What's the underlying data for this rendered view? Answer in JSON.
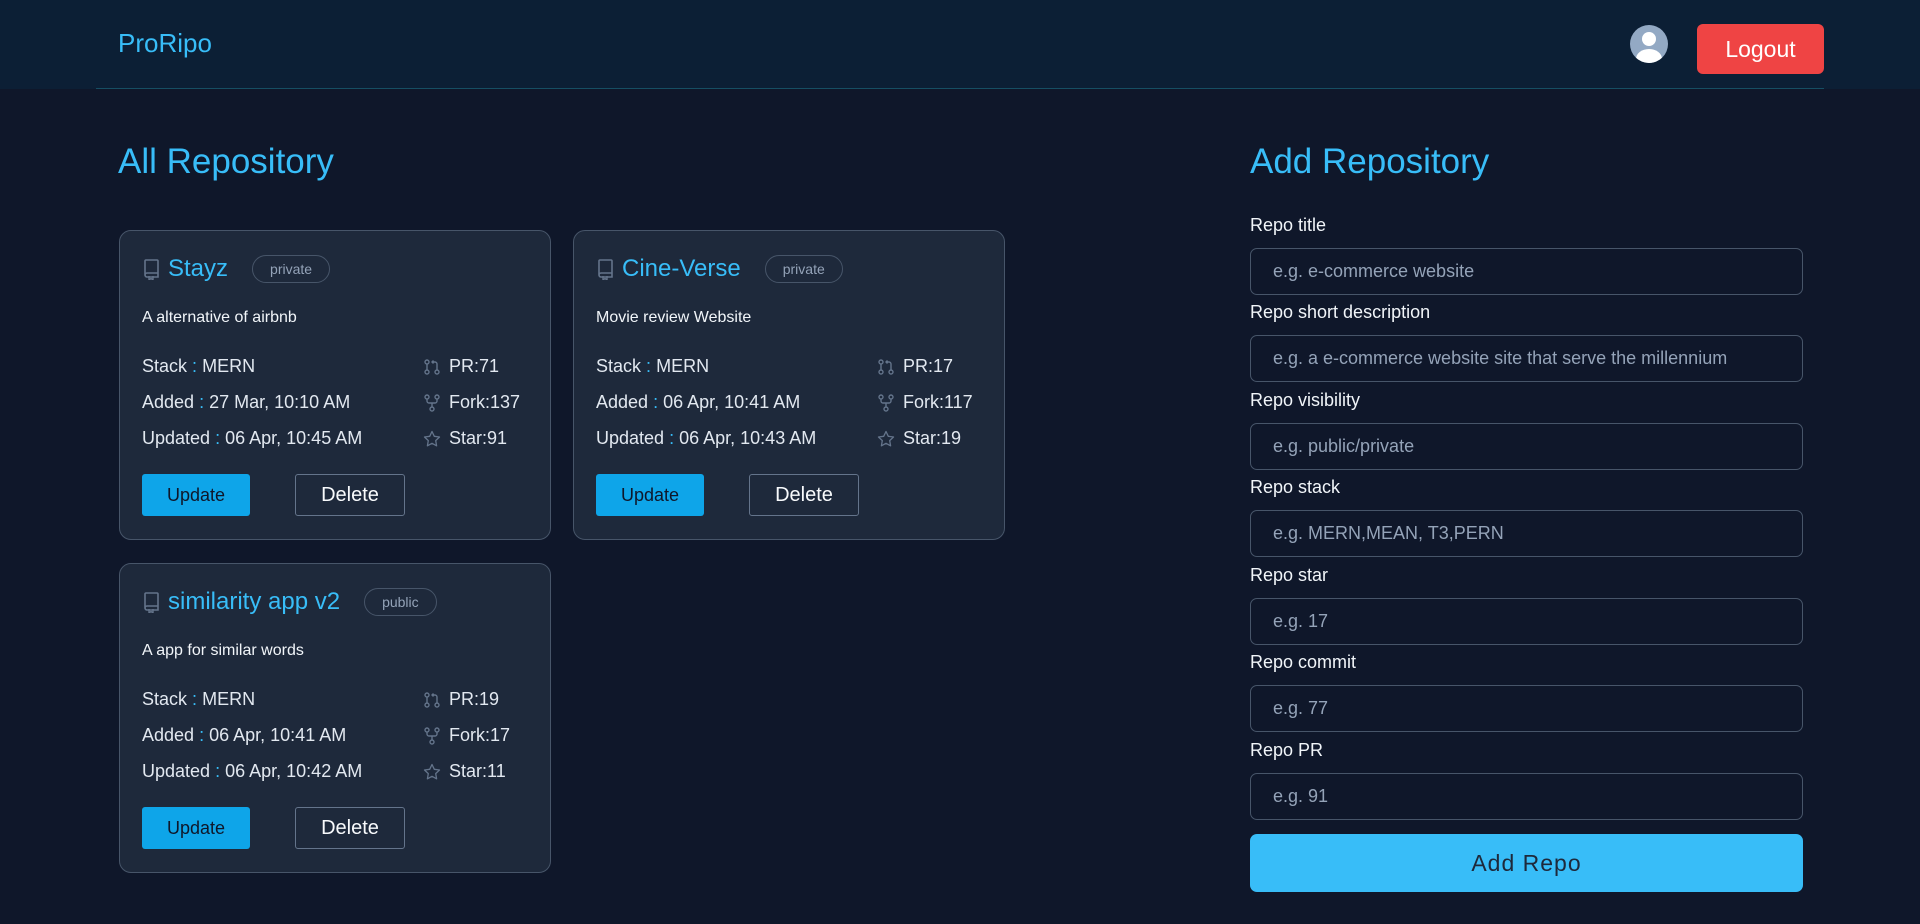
{
  "header": {
    "brand": "ProRipo",
    "logout_label": "Logout"
  },
  "repos_section": {
    "title": "All Repository"
  },
  "add_section": {
    "title": "Add Repository"
  },
  "repos": [
    {
      "title": "Stayz",
      "visibility": "private",
      "description": "A alternative of airbnb",
      "stack_label": "Stack",
      "stack": "MERN",
      "added_label": "Added",
      "added": "27 Mar, 10:10 AM",
      "updated_label": "Updated",
      "updated": "06 Apr, 10:45 AM",
      "pr": "PR:71",
      "fork": "Fork:137",
      "star": "Star:91",
      "update_label": "Update",
      "delete_label": "Delete"
    },
    {
      "title": "Cine-Verse",
      "visibility": "private",
      "description": "Movie review Website",
      "stack_label": "Stack",
      "stack": "MERN",
      "added_label": "Added",
      "added": "06 Apr, 10:41 AM",
      "updated_label": "Updated",
      "updated": "06 Apr, 10:43 AM",
      "pr": "PR:17",
      "fork": "Fork:117",
      "star": "Star:19",
      "update_label": "Update",
      "delete_label": "Delete"
    },
    {
      "title": "similarity app v2",
      "visibility": "public",
      "description": "A app for similar words",
      "stack_label": "Stack",
      "stack": "MERN",
      "added_label": "Added",
      "added": "06 Apr, 10:41 AM",
      "updated_label": "Updated",
      "updated": "06 Apr, 10:42 AM",
      "pr": "PR:19",
      "fork": "Fork:17",
      "star": "Star:11",
      "update_label": "Update",
      "delete_label": "Delete"
    }
  ],
  "form": {
    "title_label": "Repo title",
    "title_placeholder": "e.g. e-commerce website",
    "desc_label": "Repo short description",
    "desc_placeholder": "e.g. a e-commerce website site that serve the millennium",
    "visibility_label": "Repo visibility",
    "visibility_placeholder": "e.g. public/private",
    "stack_label": "Repo stack",
    "stack_placeholder": "e.g. MERN,MEAN, T3,PERN",
    "star_label": "Repo star",
    "star_placeholder": "e.g. 17",
    "commit_label": "Repo commit",
    "commit_placeholder": "e.g. 77",
    "pr_label": "Repo PR",
    "pr_placeholder": "e.g. 91",
    "submit_label": "Add Repo"
  },
  "colors": {
    "background": "#0f172a",
    "accent": "#38bdf8",
    "danger": "#ef4444",
    "card": "#1e293b"
  },
  "icons": {
    "repo": "book-icon",
    "pr": "pull-request-icon",
    "fork": "fork-icon",
    "star": "star-icon",
    "avatar": "user-avatar-icon"
  }
}
